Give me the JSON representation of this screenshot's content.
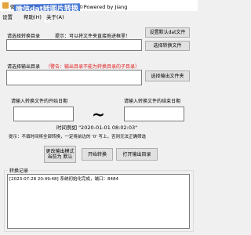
{
  "window": {
    "title": "微信dat转图片转换器 v1.3.3 ©Powered by Jiang",
    "watermark": "微信dat转图片转换器"
  },
  "menu": [
    "设置",
    "帮助(H)",
    "关于(A)"
  ],
  "source": {
    "label": "请选择转换目录",
    "hint": "提示：可以将文件夹直接拖进框里！",
    "value": "",
    "set_default_button": "设置默认dat文件",
    "select_button": "选择转换文件"
  },
  "output": {
    "label": "请选择输出目录",
    "warning": "（警告：输出目录不能为转换目录的子目录）",
    "value": "",
    "select_button": "选择输出文件夹"
  },
  "date_range": {
    "start_label": "请输入转换文件的开始日期",
    "end_label": "请输入转换文件的结束日期",
    "start_value": "",
    "end_value": "",
    "separator": "~",
    "example": "时间例如 \"2020-01-01 08:02:03\"",
    "tip": "提示：不填时间将全部转换，一定将前边的 '0' 写上，否则无法正确筛选"
  },
  "actions": {
    "mode_button": "更改输出模式\n当前为 默认",
    "start_button": "开始转换",
    "open_output_button": "打开输出目录"
  },
  "log": {
    "title": "转换记录",
    "lines": [
      "[2023-07-28 20:49:48]  系统初始化完成，端口：8484"
    ]
  }
}
